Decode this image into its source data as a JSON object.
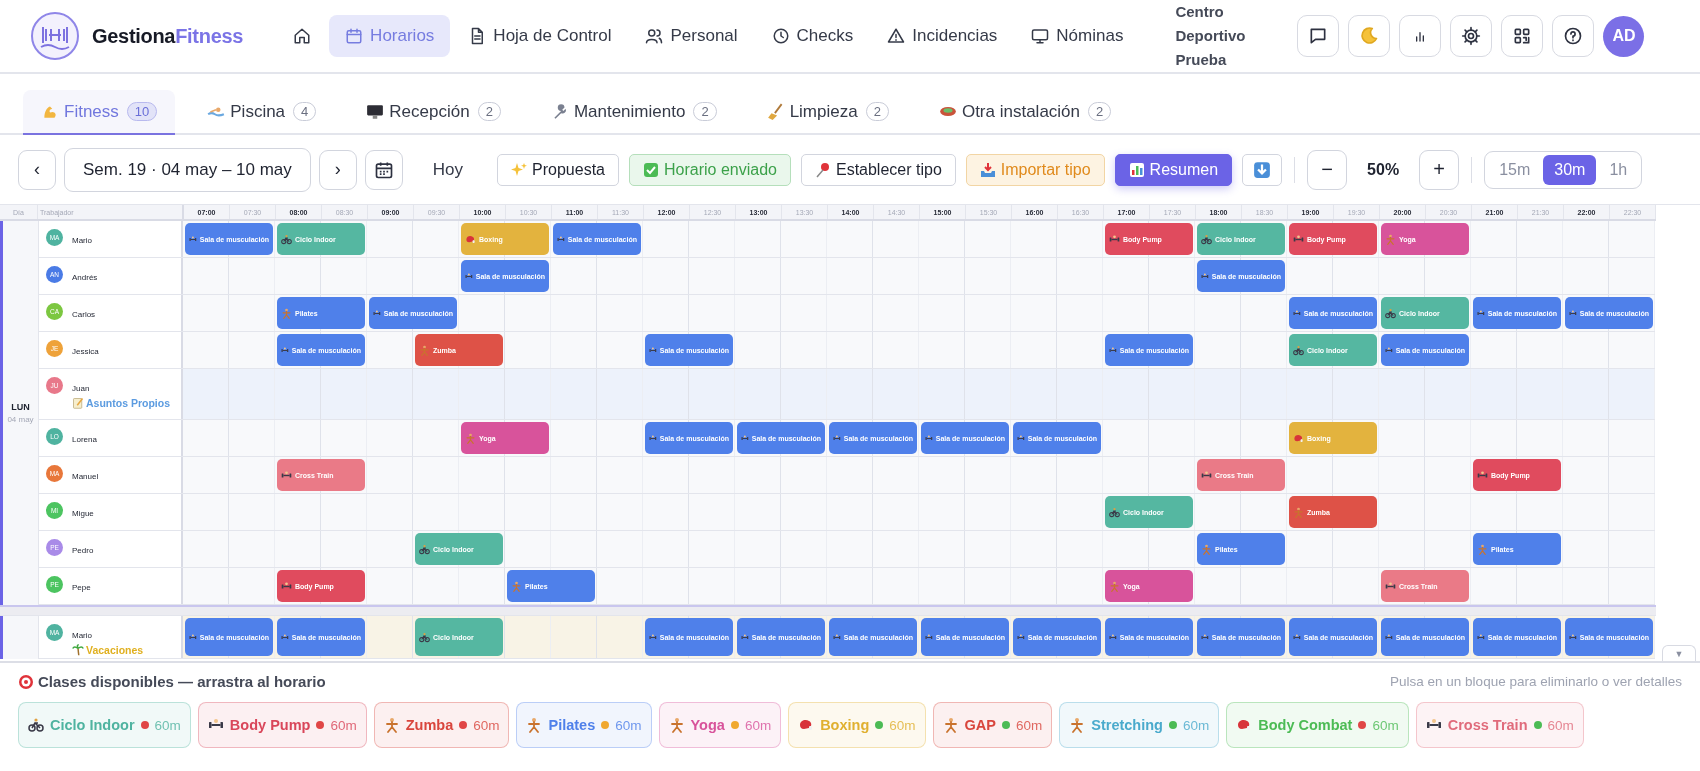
{
  "brand": {
    "first": "Gestiona",
    "second": "Fitness"
  },
  "nav": [
    {
      "selected": false
    },
    {
      "label": "Horarios",
      "selected": true
    },
    {
      "label": "Hoja de Control",
      "selected": false
    },
    {
      "label": "Personal",
      "selected": false
    },
    {
      "label": "Checks",
      "selected": false
    },
    {
      "label": "Incidencias",
      "selected": false
    },
    {
      "label": "Nóminas",
      "selected": false
    }
  ],
  "center_name": "Centro Deportivo Prueba",
  "user_initials": "AD",
  "tabs": [
    {
      "label": "Fitness",
      "count": "10",
      "selected": true
    },
    {
      "label": "Piscina",
      "count": "4",
      "selected": false
    },
    {
      "label": "Recepción",
      "count": "2",
      "selected": false
    },
    {
      "label": "Mantenimiento",
      "count": "2",
      "selected": false
    },
    {
      "label": "Limpieza",
      "count": "2",
      "selected": false
    },
    {
      "label": "Otra instalación",
      "count": "2",
      "selected": false
    }
  ],
  "toolbar": {
    "prev": "‹",
    "week": "Sem. 19 · 04 may – 10 may",
    "next": "›",
    "today": "Hoy",
    "actions": [
      {
        "label": "Propuesta",
        "kind": "sparkle"
      },
      {
        "label": "Horario enviado",
        "kind": "sent"
      },
      {
        "label": "Establecer tipo",
        "kind": "pin"
      },
      {
        "label": "Importar tipo",
        "kind": "import"
      },
      {
        "label": "Resumen",
        "kind": "summary"
      }
    ],
    "zoom_out": "−",
    "zoom": "50%",
    "zoom_in": "+",
    "intervals": [
      {
        "label": "15m",
        "selected": false
      },
      {
        "label": "30m",
        "selected": true
      },
      {
        "label": "1h",
        "selected": false
      }
    ]
  },
  "grid": {
    "day_header": "Día",
    "worker_header": "Trabajador",
    "times": [
      {
        "label": "07:00",
        "major": true
      },
      {
        "label": "07:30",
        "major": false
      },
      {
        "label": "08:00",
        "major": true
      },
      {
        "label": "08:30",
        "major": false
      },
      {
        "label": "09:00",
        "major": true
      },
      {
        "label": "09:30",
        "major": false
      },
      {
        "label": "10:00",
        "major": true
      },
      {
        "label": "10:30",
        "major": false
      },
      {
        "label": "11:00",
        "major": true
      },
      {
        "label": "11:30",
        "major": false
      },
      {
        "label": "12:00",
        "major": true
      },
      {
        "label": "12:30",
        "major": false
      },
      {
        "label": "13:00",
        "major": true
      },
      {
        "label": "13:30",
        "major": false
      },
      {
        "label": "14:00",
        "major": true
      },
      {
        "label": "14:30",
        "major": false
      },
      {
        "label": "15:00",
        "major": true
      },
      {
        "label": "15:30",
        "major": false
      },
      {
        "label": "16:00",
        "major": true
      },
      {
        "label": "16:30",
        "major": false
      },
      {
        "label": "17:00",
        "major": true
      },
      {
        "label": "17:30",
        "major": false
      },
      {
        "label": "18:00",
        "major": true
      },
      {
        "label": "18:30",
        "major": false
      },
      {
        "label": "19:00",
        "major": true
      },
      {
        "label": "19:30",
        "major": false
      },
      {
        "label": "20:00",
        "major": true
      },
      {
        "label": "20:30",
        "major": false
      },
      {
        "label": "21:00",
        "major": true
      },
      {
        "label": "21:30",
        "major": false
      },
      {
        "label": "22:00",
        "major": true
      },
      {
        "label": "22:30",
        "major": false
      }
    ],
    "days": [
      {
        "label": "LUN",
        "date": "04 may",
        "workers": [
          {
            "name": "Mario",
            "initials": "MA",
            "color": "#4fb3a0",
            "cells": [
              {
                "label": "Sala de musculación",
                "kind": "weights",
                "color": "#4f80ea"
              },
              {
                "label": "Ciclo Indoor",
                "kind": "bike",
                "color": "#55b7a1"
              },
              {
                "kind": "gap"
              },
              {
                "kind": "gap"
              },
              {
                "label": "Boxing",
                "kind": "glove",
                "color": "#e3b33e"
              },
              {
                "label": "Sala de musculación",
                "kind": "weights",
                "color": "#4f80ea"
              },
              {
                "kind": "gap"
              },
              {
                "kind": "gap"
              },
              {
                "kind": "gap"
              },
              {
                "kind": "gap"
              },
              {
                "kind": "gap"
              },
              {
                "kind": "gap"
              },
              {
                "kind": "gap"
              },
              {
                "kind": "gap"
              },
              {
                "kind": "gap"
              },
              {
                "kind": "gap"
              },
              {
                "label": "Body Pump",
                "kind": "weights",
                "color": "#e04b5e"
              },
              {
                "label": "Ciclo Indoor",
                "kind": "bike",
                "color": "#55b7a1"
              },
              {
                "label": "Body Pump",
                "kind": "weights",
                "color": "#e04b5e"
              },
              {
                "label": "Yoga",
                "kind": "figure",
                "color": "#d8539b"
              }
            ]
          },
          {
            "name": "Andrés",
            "initials": "AN",
            "color": "#4a7be6",
            "cells": [
              {
                "kind": "gap"
              },
              {
                "kind": "gap"
              },
              {
                "kind": "gap"
              },
              {
                "kind": "gap"
              },
              {
                "kind": "gap"
              },
              {
                "kind": "gap"
              },
              {
                "label": "Sala de musculación",
                "kind": "weights",
                "color": "#4f80ea"
              },
              {
                "kind": "gap"
              },
              {
                "kind": "gap"
              },
              {
                "kind": "gap"
              },
              {
                "kind": "gap"
              },
              {
                "kind": "gap"
              },
              {
                "kind": "gap"
              },
              {
                "kind": "gap"
              },
              {
                "kind": "gap"
              },
              {
                "kind": "gap"
              },
              {
                "kind": "gap"
              },
              {
                "kind": "gap"
              },
              {
                "kind": "gap"
              },
              {
                "kind": "gap"
              },
              {
                "kind": "gap"
              },
              {
                "label": "Sala de musculación",
                "kind": "weights",
                "color": "#4f80ea"
              }
            ]
          },
          {
            "name": "Carlos",
            "initials": "CA",
            "color": "#7cc740",
            "cells": [
              {
                "kind": "gap"
              },
              {
                "kind": "gap"
              },
              {
                "label": "Pilates",
                "kind": "figure",
                "color": "#4f80ea"
              },
              {
                "label": "Sala de musculación",
                "kind": "weights",
                "color": "#4f80ea"
              },
              {
                "kind": "gap"
              },
              {
                "kind": "gap"
              },
              {
                "kind": "gap"
              },
              {
                "kind": "gap"
              },
              {
                "kind": "gap"
              },
              {
                "kind": "gap"
              },
              {
                "kind": "gap"
              },
              {
                "kind": "gap"
              },
              {
                "kind": "gap"
              },
              {
                "kind": "gap"
              },
              {
                "kind": "gap"
              },
              {
                "kind": "gap"
              },
              {
                "kind": "gap"
              },
              {
                "kind": "gap"
              },
              {
                "kind": "gap"
              },
              {
                "kind": "gap"
              },
              {
                "kind": "gap"
              },
              {
                "kind": "gap"
              },
              {
                "label": "Sala de musculación",
                "kind": "weights",
                "color": "#4f80ea"
              },
              {
                "label": "Ciclo Indoor",
                "kind": "bike",
                "color": "#55b7a1"
              },
              {
                "label": "Sala de musculación",
                "kind": "weights",
                "color": "#4f80ea"
              },
              {
                "label": "Sala de musculación",
                "kind": "weights",
                "color": "#4f80ea"
              }
            ]
          },
          {
            "name": "Jessica",
            "initials": "JE",
            "color": "#eea23a",
            "cells": [
              {
                "kind": "gap"
              },
              {
                "kind": "gap"
              },
              {
                "label": "Sala de musculación",
                "kind": "weights",
                "color": "#4f80ea"
              },
              {
                "kind": "gap"
              },
              {
                "label": "Zumba",
                "kind": "figure",
                "color": "#de5247"
              },
              {
                "kind": "gap"
              },
              {
                "kind": "gap"
              },
              {
                "kind": "gap"
              },
              {
                "label": "Sala de musculación",
                "kind": "weights",
                "color": "#4f80ea"
              },
              {
                "kind": "gap"
              },
              {
                "kind": "gap"
              },
              {
                "kind": "gap"
              },
              {
                "kind": "gap"
              },
              {
                "kind": "gap"
              },
              {
                "kind": "gap"
              },
              {
                "kind": "gap"
              },
              {
                "kind": "gap"
              },
              {
                "label": "Sala de musculación",
                "kind": "weights",
                "color": "#4f80ea"
              },
              {
                "kind": "gap"
              },
              {
                "kind": "gap"
              },
              {
                "label": "Ciclo Indoor",
                "kind": "bike",
                "color": "#55b7a1"
              },
              {
                "label": "Sala de musculación",
                "kind": "weights",
                "color": "#4f80ea"
              }
            ]
          },
          {
            "name": "Juan",
            "initials": "JU",
            "color": "#e8788a",
            "absence": {
              "label": "Asuntos Propios",
              "kind": "personal"
            }
          },
          {
            "name": "Lorena",
            "initials": "LO",
            "color": "#4fb3a0",
            "cells": [
              {
                "kind": "gap"
              },
              {
                "kind": "gap"
              },
              {
                "kind": "gap"
              },
              {
                "kind": "gap"
              },
              {
                "kind": "gap"
              },
              {
                "kind": "gap"
              },
              {
                "label": "Yoga",
                "kind": "figure",
                "color": "#d8539b"
              },
              {
                "kind": "gap"
              },
              {
                "kind": "gap"
              },
              {
                "label": "Sala de musculación",
                "kind": "weights",
                "color": "#4f80ea"
              },
              {
                "label": "Sala de musculación",
                "kind": "weights",
                "color": "#4f80ea"
              },
              {
                "label": "Sala de musculación",
                "kind": "weights",
                "color": "#4f80ea"
              },
              {
                "label": "Sala de musculación",
                "kind": "weights",
                "color": "#4f80ea"
              },
              {
                "label": "Sala de musculación",
                "kind": "weights",
                "color": "#4f80ea"
              },
              {
                "kind": "gap"
              },
              {
                "kind": "gap"
              },
              {
                "kind": "gap"
              },
              {
                "kind": "gap"
              },
              {
                "label": "Boxing",
                "kind": "glove",
                "color": "#e3b33e"
              }
            ]
          },
          {
            "name": "Manuel",
            "initials": "MA",
            "color": "#e8773a",
            "cells": [
              {
                "kind": "gap"
              },
              {
                "kind": "gap"
              },
              {
                "label": "Cross Train",
                "kind": "weights",
                "color": "#ea7a87"
              },
              {
                "kind": "gap"
              },
              {
                "kind": "gap"
              },
              {
                "kind": "gap"
              },
              {
                "kind": "gap"
              },
              {
                "kind": "gap"
              },
              {
                "kind": "gap"
              },
              {
                "kind": "gap"
              },
              {
                "kind": "gap"
              },
              {
                "kind": "gap"
              },
              {
                "kind": "gap"
              },
              {
                "kind": "gap"
              },
              {
                "kind": "gap"
              },
              {
                "kind": "gap"
              },
              {
                "kind": "gap"
              },
              {
                "kind": "gap"
              },
              {
                "kind": "gap"
              },
              {
                "kind": "gap"
              },
              {
                "kind": "gap"
              },
              {
                "label": "Cross Train",
                "kind": "weights",
                "color": "#ea7a87"
              },
              {
                "kind": "gap"
              },
              {
                "kind": "gap"
              },
              {
                "kind": "gap"
              },
              {
                "kind": "gap"
              },
              {
                "label": "Body Pump",
                "kind": "weights",
                "color": "#e04b5e"
              }
            ]
          },
          {
            "name": "Migue",
            "initials": "MI",
            "color": "#4cc460",
            "cells": [
              {
                "kind": "gap"
              },
              {
                "kind": "gap"
              },
              {
                "kind": "gap"
              },
              {
                "kind": "gap"
              },
              {
                "kind": "gap"
              },
              {
                "kind": "gap"
              },
              {
                "kind": "gap"
              },
              {
                "kind": "gap"
              },
              {
                "kind": "gap"
              },
              {
                "kind": "gap"
              },
              {
                "kind": "gap"
              },
              {
                "kind": "gap"
              },
              {
                "kind": "gap"
              },
              {
                "kind": "gap"
              },
              {
                "kind": "gap"
              },
              {
                "kind": "gap"
              },
              {
                "kind": "gap"
              },
              {
                "kind": "gap"
              },
              {
                "kind": "gap"
              },
              {
                "kind": "gap"
              },
              {
                "label": "Ciclo Indoor",
                "kind": "bike",
                "color": "#55b7a1"
              },
              {
                "kind": "gap"
              },
              {
                "kind": "gap"
              },
              {
                "label": "Zumba",
                "kind": "figure",
                "color": "#de5247"
              }
            ]
          },
          {
            "name": "Pedro",
            "initials": "PE",
            "color": "#a98be8",
            "cells": [
              {
                "kind": "gap"
              },
              {
                "kind": "gap"
              },
              {
                "kind": "gap"
              },
              {
                "kind": "gap"
              },
              {
                "kind": "gap"
              },
              {
                "label": "Ciclo Indoor",
                "kind": "bike",
                "color": "#55b7a1"
              },
              {
                "kind": "gap"
              },
              {
                "kind": "gap"
              },
              {
                "kind": "gap"
              },
              {
                "kind": "gap"
              },
              {
                "kind": "gap"
              },
              {
                "kind": "gap"
              },
              {
                "kind": "gap"
              },
              {
                "kind": "gap"
              },
              {
                "kind": "gap"
              },
              {
                "kind": "gap"
              },
              {
                "kind": "gap"
              },
              {
                "kind": "gap"
              },
              {
                "kind": "gap"
              },
              {
                "kind": "gap"
              },
              {
                "kind": "gap"
              },
              {
                "label": "Pilates",
                "kind": "figure",
                "color": "#4f80ea"
              },
              {
                "kind": "gap"
              },
              {
                "kind": "gap"
              },
              {
                "kind": "gap"
              },
              {
                "kind": "gap"
              },
              {
                "label": "Pilates",
                "kind": "figure",
                "color": "#4f80ea"
              }
            ]
          },
          {
            "name": "Pepe",
            "initials": "PE",
            "color": "#4cc460",
            "cells": [
              {
                "kind": "gap"
              },
              {
                "kind": "gap"
              },
              {
                "label": "Body Pump",
                "kind": "weights",
                "color": "#e04b5e"
              },
              {
                "kind": "gap"
              },
              {
                "kind": "gap"
              },
              {
                "kind": "gap"
              },
              {
                "label": "Pilates",
                "kind": "figure",
                "color": "#4f80ea"
              },
              {
                "kind": "gap"
              },
              {
                "kind": "gap"
              },
              {
                "kind": "gap"
              },
              {
                "kind": "gap"
              },
              {
                "kind": "gap"
              },
              {
                "kind": "gap"
              },
              {
                "kind": "gap"
              },
              {
                "kind": "gap"
              },
              {
                "kind": "gap"
              },
              {
                "kind": "gap"
              },
              {
                "kind": "gap"
              },
              {
                "label": "Yoga",
                "kind": "figure",
                "color": "#d8539b"
              },
              {
                "kind": "gap"
              },
              {
                "kind": "gap"
              },
              {
                "kind": "gap"
              },
              {
                "kind": "gap"
              },
              {
                "label": "Cross Train",
                "kind": "weights",
                "color": "#ea7a87"
              }
            ]
          }
        ]
      },
      {
        "workers": [
          {
            "name": "Mario",
            "initials": "MA",
            "color": "#4fb3a0",
            "absence": {
              "label": "Vacaciones",
              "kind": "vacation"
            },
            "cells": [
              {
                "label": "Sala de musculación",
                "kind": "weights",
                "color": "#4f80ea"
              },
              {
                "label": "Sala de musculación",
                "kind": "weights",
                "color": "#4f80ea"
              },
              {
                "kind": "gap"
              },
              {
                "label": "Ciclo Indoor",
                "kind": "bike",
                "color": "#55b7a1"
              },
              {
                "kind": "gap"
              },
              {
                "kind": "gap"
              },
              {
                "kind": "gap"
              },
              {
                "label": "Sala de musculación",
                "kind": "weights",
                "color": "#4f80ea"
              },
              {
                "label": "Sala de musculación",
                "kind": "weights",
                "color": "#4f80ea"
              },
              {
                "label": "Sala de musculación",
                "kind": "weights",
                "color": "#4f80ea"
              },
              {
                "label": "Sala de musculación",
                "kind": "weights",
                "color": "#4f80ea"
              },
              {
                "label": "Sala de musculación",
                "kind": "weights",
                "color": "#4f80ea"
              },
              {
                "label": "Sala de musculación",
                "kind": "weights",
                "color": "#4f80ea"
              },
              {
                "label": "Sala de musculación",
                "kind": "weights",
                "color": "#4f80ea"
              },
              {
                "label": "Sala de musculación",
                "kind": "weights",
                "color": "#4f80ea"
              },
              {
                "label": "Sala de musculación",
                "kind": "weights",
                "color": "#4f80ea"
              },
              {
                "label": "Sala de musculación",
                "kind": "weights",
                "color": "#4f80ea"
              },
              {
                "label": "Sala de musculación",
                "kind": "weights",
                "color": "#4f80ea"
              }
            ]
          }
        ]
      }
    ],
    "scroll_button": "▼"
  },
  "palette": {
    "title": "Clases disponibles — arrastra al horario",
    "hint": "Pulsa en un bloque para eliminarlo o ver detalles",
    "classes": [
      {
        "label": "Ciclo Indoor",
        "duration": "60m",
        "kind": "bike",
        "color": "#4fb3a0",
        "dot": {
          "color": "#e04646"
        }
      },
      {
        "label": "Body Pump",
        "duration": "60m",
        "kind": "weights",
        "color": "#d9465a",
        "dot": {
          "color": "#e04646"
        }
      },
      {
        "label": "Zumba",
        "duration": "60m",
        "kind": "figure",
        "color": "#d9463d",
        "dot": {
          "color": "#e04646"
        }
      },
      {
        "label": "Pilates",
        "duration": "60m",
        "kind": "figure",
        "color": "#4f80ea",
        "dot": {
          "color": "#f0a830"
        }
      },
      {
        "label": "Yoga",
        "duration": "60m",
        "kind": "figure",
        "color": "#d8539b",
        "dot": {
          "color": "#f0a830"
        }
      },
      {
        "label": "Boxing",
        "duration": "60m",
        "kind": "glove",
        "color": "#e0b030",
        "dot": {
          "color": "#4cbb55"
        }
      },
      {
        "label": "GAP",
        "duration": "60m",
        "kind": "figure",
        "color": "#d9463d",
        "dot": {
          "color": "#4cbb55"
        }
      },
      {
        "label": "Stretching",
        "duration": "60m",
        "kind": "figure",
        "color": "#4aaacc",
        "dot": {
          "color": "#4cbb55"
        }
      },
      {
        "label": "Body Combat",
        "duration": "60m",
        "kind": "glove",
        "color": "#4cbb55",
        "dot": {
          "color": "#e04646"
        }
      },
      {
        "label": "Cross Train",
        "duration": "60m",
        "kind": "weights",
        "color": "#e06b7b",
        "dot": {
          "color": "#4cbb55"
        }
      }
    ]
  }
}
